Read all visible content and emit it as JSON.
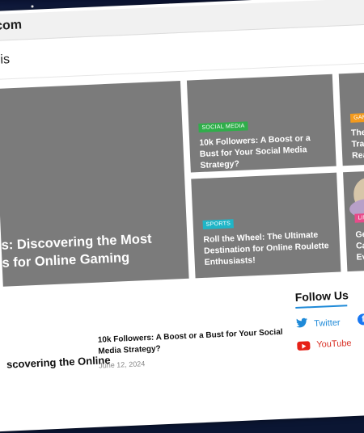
{
  "browser": {
    "url_fragment": ".com"
  },
  "search": {
    "value_fragment": "his"
  },
  "featured": {
    "big": {
      "title_line1": "s: Discovering the Most",
      "title_line2": "s for Online Gaming"
    },
    "tile1": {
      "category": "SOCIAL MEDIA",
      "title": "10k Followers: A Boost or a Bust for Your Social Media Strategy?"
    },
    "tile2": {
      "category": "GAMIN",
      "title_line1": "The",
      "title_line2": "Tran",
      "title_line3": "Real"
    },
    "tile3": {
      "category": "SPORTS",
      "title": "Roll the Wheel: The Ultimate Destination for Online Roulette Enthusiasts!"
    },
    "tile4": {
      "category": "LIFES",
      "title_line1": "Get",
      "title_line2": "Cas",
      "title_line3": "Eve"
    }
  },
  "recent": {
    "main_title_fragment": "scovering the Online",
    "post": {
      "title": "10k Followers: A Boost or a Bust for Your Social Media Strategy?",
      "date": "June 12, 2024"
    }
  },
  "follow": {
    "heading": "Follow Us",
    "twitter": "Twitter",
    "youtube": "YouTube"
  },
  "colors": {
    "social_media_badge": "#2fae4a",
    "sports_badge": "#1fb5c7",
    "gaming_badge": "#f39a1e",
    "lifestyle_badge": "#e84b8a",
    "link_blue": "#1f8ad8"
  }
}
